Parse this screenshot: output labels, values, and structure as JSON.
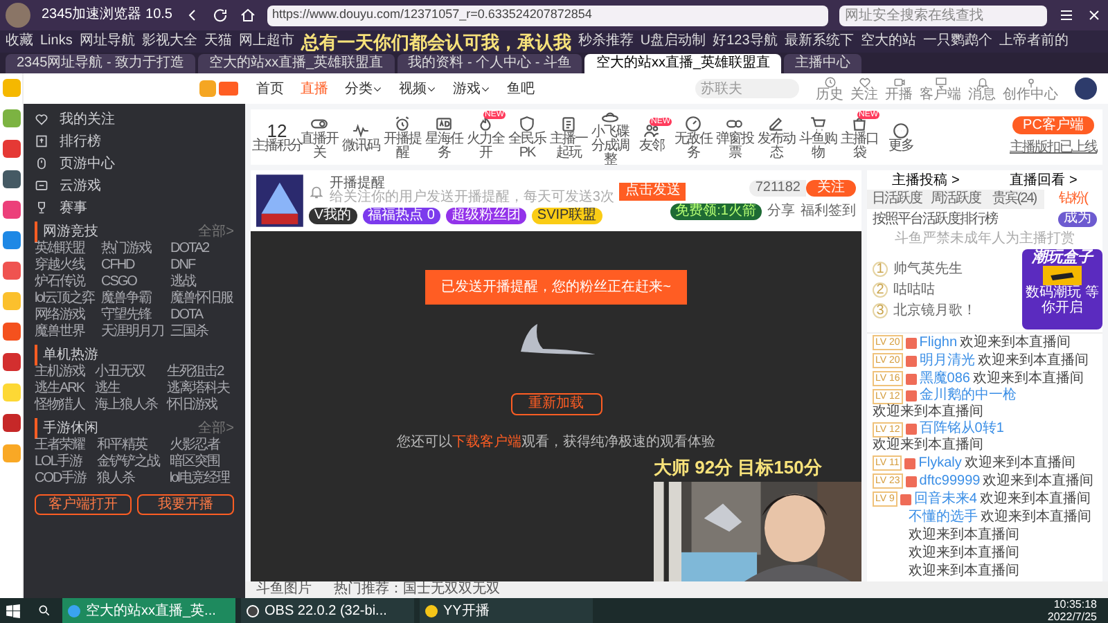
{
  "browser": {
    "title": "2345加速浏览器 10.5",
    "url": "https://www.douyu.com/12371057_r=0.633524207872854",
    "search": {
      "placeholder": "网址安全搜索在线查找"
    }
  },
  "bookmarks": [
    "收藏",
    "Links",
    "网址导航",
    "影视大全",
    "天猫",
    "网上超市",
    "秒杀推荐",
    "U盘启动制",
    "好123导航",
    "最新系统下",
    "空大的站",
    "一只鹦鹉个",
    "上帝者前的"
  ],
  "tabs": [
    {
      "label": "2345网址导航 - 致力于打造",
      "selected": false
    },
    {
      "label": "空大的站xx直播_英雄联盟直",
      "selected": false
    },
    {
      "label": "我的资料 - 个人中心 - 斗鱼",
      "selected": false
    },
    {
      "label": "空大的站xx直播_英雄联盟直",
      "selected": true
    },
    {
      "label": "主播中心",
      "selected": false
    }
  ],
  "stream_overlay": {
    "caption": "总有一天你们都会认可我，承认我",
    "score": "大师 92分 目标150分"
  },
  "side_apps": [
    {
      "color": "#f5b800"
    },
    {
      "color": "#7cb342"
    },
    {
      "color": "#e53935"
    },
    {
      "color": "#455a64"
    },
    {
      "color": "#ec407a"
    },
    {
      "color": "#1e88e5"
    },
    {
      "color": "#ef5350"
    },
    {
      "color": "#fbc02d"
    },
    {
      "color": "#f4511e"
    },
    {
      "color": "#d32f2f"
    },
    {
      "color": "#fdd835"
    },
    {
      "color": "#c62828"
    },
    {
      "color": "#f9a825"
    }
  ],
  "sidebar": {
    "items": [
      {
        "label": "我的关注",
        "kind": "heart"
      },
      {
        "label": "排行榜",
        "kind": "rank"
      },
      {
        "label": "页游中心",
        "kind": "game"
      },
      {
        "label": "云游戏",
        "kind": "cloud"
      },
      {
        "label": "赛事",
        "kind": "trophy"
      }
    ],
    "sections": [
      {
        "title": "网游竞技",
        "more": "全部>",
        "games": [
          "英雄联盟",
          "热门游戏",
          "DOTA2",
          "穿越火线",
          "CFHD",
          "DNF",
          "炉石传说",
          "CSGO",
          "逃战",
          "lol云顶之弈",
          "魔兽争霸",
          "魔兽怀旧服",
          "网络游戏",
          "守望先锋",
          "DOTA",
          "魔兽世界",
          "天涯明月刀",
          "三国杀"
        ]
      },
      {
        "title": "单机热游",
        "games": [
          "主机游戏",
          "小丑无双",
          "生死狙击2",
          "逃生ARK",
          "逃生",
          "逃离塔科夫",
          "怪物猎人",
          "海上狼人杀",
          "怀旧游戏"
        ]
      },
      {
        "title": "手游休闲",
        "more": "全部>",
        "games": [
          "王者荣耀",
          "和平精英",
          "火影忍者",
          "LOL手游",
          "金铲铲之战",
          "暗区突围",
          "COD手游",
          "狼人杀",
          "lol电竞经理"
        ]
      }
    ],
    "buttons": [
      "客户端打开",
      "我要开播"
    ]
  },
  "header": {
    "nav": [
      {
        "label": "首页",
        "selected": false,
        "dropdown": false
      },
      {
        "label": "直播",
        "selected": true,
        "dropdown": false
      },
      {
        "label": "分类",
        "selected": false,
        "dropdown": true
      },
      {
        "label": "视频",
        "selected": false,
        "dropdown": true
      },
      {
        "label": "游戏",
        "selected": false,
        "dropdown": true
      },
      {
        "label": "鱼吧",
        "selected": false,
        "dropdown": false
      }
    ],
    "search": {
      "placeholder": "苏联夫"
    },
    "icons": [
      {
        "label": "历史",
        "kind": "clock"
      },
      {
        "label": "关注",
        "kind": "heart"
      },
      {
        "label": "开播",
        "kind": "video"
      },
      {
        "label": "客户端",
        "kind": "monitor"
      },
      {
        "label": "消息",
        "kind": "bell"
      },
      {
        "label": "创作中心",
        "kind": "pin"
      }
    ]
  },
  "toolbar": {
    "score": "12",
    "score_label": "主播积分",
    "items": [
      {
        "label": "直播开关",
        "kind": "toggle"
      },
      {
        "label": "微讯码",
        "kind": "wave"
      },
      {
        "label": "开播提醒",
        "kind": "alarm"
      },
      {
        "label": "星海任务",
        "kind": "ad"
      },
      {
        "label": "火力全开",
        "kind": "fire",
        "badge": "NEW"
      },
      {
        "label": "全民乐PK",
        "kind": "shield"
      },
      {
        "label": "主播一起玩",
        "kind": "clipboard"
      },
      {
        "label": "小飞碟分成调整",
        "kind": "ufo"
      },
      {
        "label": "友邻",
        "kind": "users",
        "badge": "NEW"
      },
      {
        "label": "无敌任务",
        "kind": "gauge"
      },
      {
        "label": "弹窗投票",
        "kind": "vote"
      },
      {
        "label": "发布动态",
        "kind": "edit"
      },
      {
        "label": "斗鱼购物",
        "kind": "cart"
      },
      {
        "label": "主播口袋",
        "kind": "bag",
        "badge": "NEW"
      },
      {
        "label": "更多",
        "kind": "more"
      }
    ],
    "pc_button": "PC客户端",
    "pc_note": "主播版扣已上线"
  },
  "room": {
    "reminder_title": "开播提醒",
    "reminder_text": "给关注你的用户发送开播提醒，每天可发送3次",
    "send_button": "点击发送",
    "badges": [
      {
        "label": "V我的",
        "color": "#333333"
      },
      {
        "label": "福福热点 0",
        "color": "#7c3aed"
      },
      {
        "label": "超级粉丝团",
        "color": "#9333ea"
      },
      {
        "label": "SVIP联盟",
        "color": "#facc15"
      }
    ],
    "followers": "721182",
    "follow_button": "关注",
    "rocket": "免费领:1火箭",
    "share": "分享",
    "signin": "福利签到"
  },
  "player": {
    "notice": "已发送开播提醒，您的粉丝正在赶来~",
    "reload_button": "重新加载",
    "hint_before": "您还可以",
    "hint_link": "下载客户端",
    "hint_after": "观看，获得纯净极速的观看体验"
  },
  "panel": {
    "links": [
      "主播投稿 >",
      "直播回看 >"
    ],
    "tabs": [
      {
        "label": "日活跃度",
        "selected": false
      },
      {
        "label": "周活跃度",
        "selected": false
      },
      {
        "label": "贵宾(24)",
        "selected": false
      },
      {
        "label": "钻粉(",
        "selected": true
      }
    ],
    "rank_title": "按照平台活跃度排行榜",
    "become_button": "成为",
    "rank_notice": "斗鱼严禁未成年人为主播打赏",
    "ranks": [
      {
        "rank": "1",
        "name": "帅气英先生"
      },
      {
        "rank": "2",
        "name": "咕咕咕"
      },
      {
        "rank": "3",
        "name": "北京镜月歌！"
      }
    ],
    "chat": [
      {
        "level": "LV 20",
        "name": "Flighn",
        "message": "欢迎来到本直播间"
      },
      {
        "level": "LV 20",
        "name": "明月清光",
        "message": "欢迎来到本直播间"
      },
      {
        "level": "LV 16",
        "name": "黑魔086",
        "message": "欢迎来到本直播间"
      },
      {
        "level": "LV 12",
        "name": "金川鹅的中一枪",
        "message": "欢迎来到本直播间"
      },
      {
        "level": "LV 12",
        "name": "百阵铭从0转1",
        "message": "欢迎来到本直播间"
      },
      {
        "level": "LV 11",
        "name": "Flykaly",
        "message": "欢迎来到本直播间"
      },
      {
        "level": "LV 23",
        "name": "dftc99999",
        "message": "欢迎来到本直播间"
      },
      {
        "level": "LV 9",
        "name": "回音未来4",
        "message": "欢迎来到本直播间"
      },
      {
        "name": "不懂的选手",
        "message": "欢迎来到本直播间"
      },
      {
        "message": "欢迎来到本直播间"
      },
      {
        "message": "欢迎来到本直播间"
      },
      {
        "message": "欢迎来到本直播间"
      }
    ],
    "ad": {
      "title": "潮玩盒子",
      "subtitle": "数码潮玩 等你开启"
    }
  },
  "status_bar": [
    "斗鱼图片",
    "热门推荐：国士无双双无双"
  ],
  "taskbar": {
    "apps": [
      {
        "label": "空大的站xx直播_英...",
        "kind": "browser",
        "selected": true
      },
      {
        "label": "OBS 22.0.2 (32-bi...",
        "kind": "obs",
        "selected": false
      },
      {
        "label": "YY开播",
        "kind": "yy",
        "selected": false
      }
    ],
    "time": "10:35:18",
    "date": "2022/7/25"
  }
}
